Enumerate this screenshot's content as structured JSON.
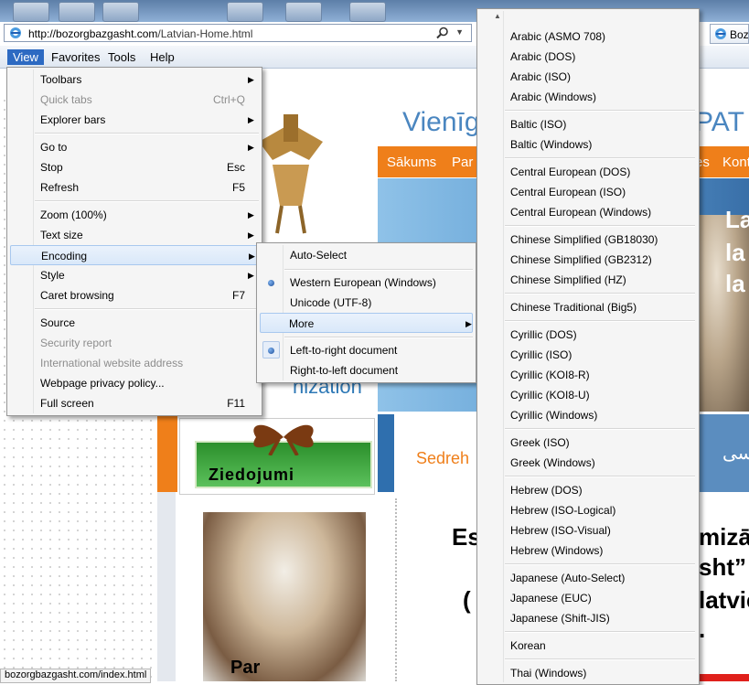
{
  "browser": {
    "address_url_domain": "http://bozorgbazgasht.com",
    "address_url_path": "/Latvian-Home.html",
    "second_tab_label": "Boz",
    "status_url": "bozorgbazgasht.com/index.html"
  },
  "menubar": {
    "view": "View",
    "favorites": "Favorites",
    "tools": "Tools",
    "help": "Help"
  },
  "view_menu": {
    "items": [
      {
        "label": "Toolbars",
        "shortcut": "",
        "submenu": true,
        "disabled": false
      },
      {
        "label": "Quick tabs",
        "shortcut": "Ctrl+Q",
        "submenu": false,
        "disabled": true
      },
      {
        "label": "Explorer bars",
        "shortcut": "",
        "submenu": true,
        "disabled": false
      },
      {
        "label": "Go to",
        "shortcut": "",
        "submenu": true,
        "disabled": false
      },
      {
        "label": "Stop",
        "shortcut": "Esc",
        "submenu": false,
        "disabled": false
      },
      {
        "label": "Refresh",
        "shortcut": "F5",
        "submenu": false,
        "disabled": false
      },
      {
        "label": "Zoom (100%)",
        "shortcut": "",
        "submenu": true,
        "disabled": false
      },
      {
        "label": "Text size",
        "shortcut": "",
        "submenu": true,
        "disabled": false
      },
      {
        "label": "Encoding",
        "shortcut": "",
        "submenu": true,
        "disabled": false
      },
      {
        "label": "Style",
        "shortcut": "",
        "submenu": true,
        "disabled": false
      },
      {
        "label": "Caret browsing",
        "shortcut": "F7",
        "submenu": false,
        "disabled": false
      },
      {
        "label": "Source",
        "shortcut": "",
        "submenu": false,
        "disabled": false
      },
      {
        "label": "Security report",
        "shortcut": "",
        "submenu": false,
        "disabled": true
      },
      {
        "label": "International website address",
        "shortcut": "",
        "submenu": false,
        "disabled": true
      },
      {
        "label": "Webpage privacy policy...",
        "shortcut": "",
        "submenu": false,
        "disabled": false
      },
      {
        "label": "Full screen",
        "shortcut": "F11",
        "submenu": false,
        "disabled": false
      }
    ]
  },
  "encoding_menu": {
    "auto_select": "Auto-Select",
    "western": "Western European (Windows)",
    "unicode": "Unicode (UTF-8)",
    "more": "More",
    "ltr": "Left-to-right document",
    "rtl": "Right-to-left document"
  },
  "more_menu": {
    "groups": [
      [
        "Arabic (ASMO 708)",
        "Arabic (DOS)",
        "Arabic (ISO)",
        "Arabic (Windows)"
      ],
      [
        "Baltic (ISO)",
        "Baltic (Windows)"
      ],
      [
        "Central European (DOS)",
        "Central European (ISO)",
        "Central European (Windows)"
      ],
      [
        "Chinese Simplified (GB18030)",
        "Chinese Simplified (GB2312)",
        "Chinese Simplified (HZ)"
      ],
      [
        "Chinese Traditional (Big5)"
      ],
      [
        "Cyrillic (DOS)",
        "Cyrillic (ISO)",
        "Cyrillic (KOI8-R)",
        "Cyrillic (KOI8-U)",
        "Cyrillic (Windows)"
      ],
      [
        "Greek (ISO)",
        "Greek (Windows)"
      ],
      [
        "Hebrew (DOS)",
        "Hebrew (ISO-Logical)",
        "Hebrew (ISO-Visual)",
        "Hebrew (Windows)"
      ],
      [
        "Japanese (Auto-Select)",
        "Japanese (EUC)",
        "Japanese (Shift-JIS)"
      ],
      [
        "Korean"
      ],
      [
        "Thai (Windows)"
      ]
    ]
  },
  "site": {
    "title_left": "Vienīg",
    "title_right": "PAT",
    "nav": [
      "Sākums",
      "Par",
      "es",
      "Kont"
    ],
    "banner_words": [
      "La",
      "la",
      "la"
    ],
    "org_fragment": "nization",
    "donate_label": "Ziedojumi",
    "sedreh_text": "Sedreh",
    "par_label": "Par",
    "headline_lines": [
      "Es",
      "mizāc",
      "sht”",
      "(",
      "latvie",
      "."
    ],
    "arabic_fragment": "سی"
  },
  "colors": {
    "menu_highlight": "#2d6ac2",
    "site_orange": "#ef7f1a",
    "site_blue": "#4a86c0"
  }
}
